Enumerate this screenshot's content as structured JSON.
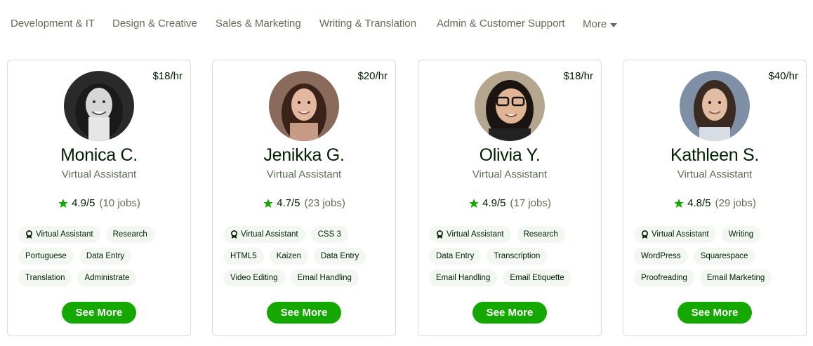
{
  "nav": {
    "items": [
      {
        "label": "Development & IT"
      },
      {
        "label": "Design & Creative"
      },
      {
        "label": "Sales & Marketing"
      },
      {
        "label": "Writing & Translation"
      },
      {
        "label": "Admin & Customer Support"
      }
    ],
    "more_label": "More"
  },
  "colors": {
    "accent": "#14a800",
    "text": "#001e00",
    "muted": "#5e6d55",
    "chip_bg": "#f2f7f2",
    "border": "#d5e0d5"
  },
  "cards": [
    {
      "rate": "$18/hr",
      "name": "Monica C.",
      "title": "Virtual Assistant",
      "score": "4.9/5",
      "jobs": "(10 jobs)",
      "skills": [
        "Virtual Assistant",
        "Research",
        "Portuguese",
        "Data Entry",
        "Translation",
        "Administrate"
      ],
      "button": "See More"
    },
    {
      "rate": "$20/hr",
      "name": "Jenikka G.",
      "title": "Virtual Assistant",
      "score": "4.7/5",
      "jobs": "(23 jobs)",
      "skills": [
        "Virtual Assistant",
        "CSS 3",
        "HTML5",
        "Kaizen",
        "Data Entry",
        "Video Editing",
        "Email Handling"
      ],
      "button": "See More"
    },
    {
      "rate": "$18/hr",
      "name": "Olivia Y.",
      "title": "Virtual Assistant",
      "score": "4.9/5",
      "jobs": "(17 jobs)",
      "skills": [
        "Virtual Assistant",
        "Research",
        "Data Entry",
        "Transcription",
        "Email Handling",
        "Email Etiquette"
      ],
      "button": "See More"
    },
    {
      "rate": "$40/hr",
      "name": "Kathleen S.",
      "title": "Virtual Assistant",
      "score": "4.8/5",
      "jobs": "(29 jobs)",
      "skills": [
        "Virtual Assistant",
        "Writing",
        "WordPress",
        "Squarespace",
        "Proofreading",
        "Email Marketing"
      ],
      "button": "See More"
    }
  ],
  "icons": {
    "rating": "star-icon",
    "top_skill": "award-badge-icon",
    "more": "caret-down-icon"
  }
}
